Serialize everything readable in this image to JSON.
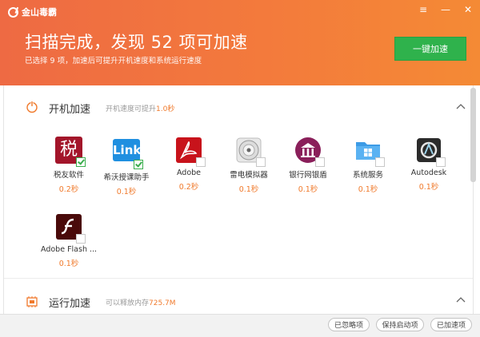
{
  "app": {
    "logo_text": "金山毒霸",
    "minimize": "—",
    "menu": "≡",
    "close": "✕"
  },
  "header": {
    "title": "扫描完成，发现 52 项可加速",
    "subtitle": "已选择 9 项，加速后可提升开机速度和系统运行速度",
    "button": "一键加速"
  },
  "startup": {
    "title": "开机加速",
    "sub_prefix": "开机速度可提升",
    "sub_value": "1.0秒",
    "items": [
      {
        "name": "税友软件",
        "value": "0.2秒",
        "checked": true
      },
      {
        "name": "希沃授课助手",
        "value": "0.1秒",
        "checked": true
      },
      {
        "name": "Adobe",
        "value": "0.2秒",
        "checked": false
      },
      {
        "name": "雷电模拟器",
        "value": "0.1秒",
        "checked": false
      },
      {
        "name": "银行网银盾",
        "value": "0.1秒",
        "checked": false
      },
      {
        "name": "系统服务",
        "value": "0.1秒",
        "checked": false
      },
      {
        "name": "Autodesk",
        "value": "0.1秒",
        "checked": false
      },
      {
        "name": "Adobe Flash ...",
        "value": "0.1秒",
        "checked": false
      }
    ]
  },
  "runtime": {
    "title": "运行加速",
    "sub_prefix": "可以释放内存",
    "sub_value": "725.7M"
  },
  "icon_text": {
    "shui": "税",
    "link": "Link"
  },
  "footer": {
    "ignored": "已忽略项",
    "kept": "保持启动项",
    "accelerated": "已加速项"
  },
  "colors": {
    "accent": "#f07a2c",
    "header": "#f37a3c",
    "button": "#2fb24c"
  }
}
